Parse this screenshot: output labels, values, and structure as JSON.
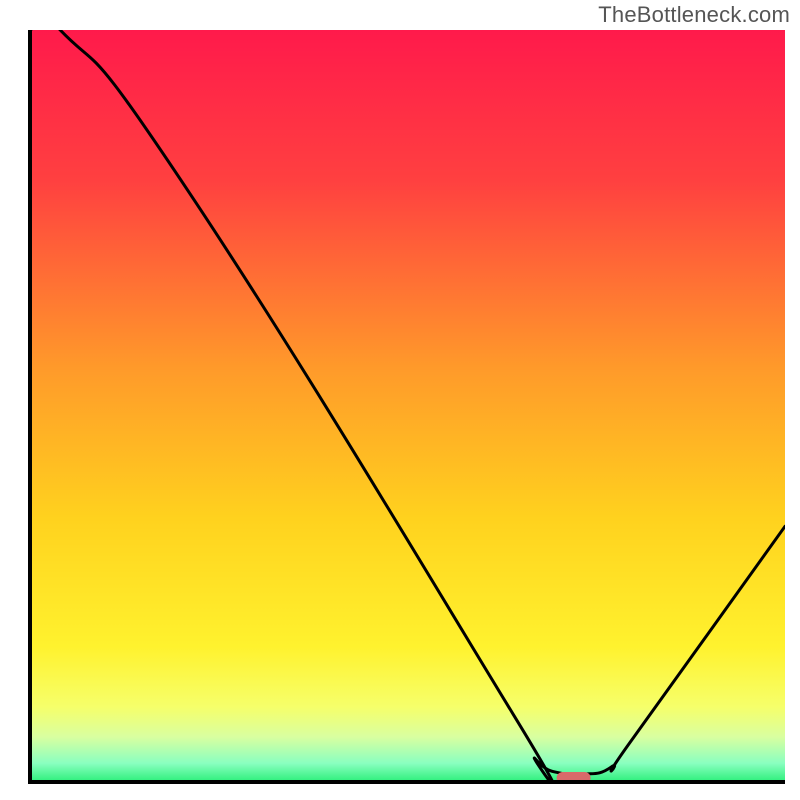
{
  "watermark": "TheBottleneck.com",
  "chart_data": {
    "type": "line",
    "title": "",
    "xlabel": "",
    "ylabel": "",
    "xlim": [
      0,
      100
    ],
    "ylim": [
      0,
      100
    ],
    "x": [
      0,
      4,
      22,
      64,
      67,
      71,
      73,
      77,
      80,
      100
    ],
    "values": [
      100,
      100,
      77,
      9,
      3,
      1,
      1,
      2,
      6,
      34
    ],
    "marker": {
      "x": 72,
      "y": 0
    },
    "gradient_stops": [
      {
        "offset": 0,
        "color": "#ff1a4b"
      },
      {
        "offset": 20,
        "color": "#ff4040"
      },
      {
        "offset": 45,
        "color": "#ff9a2a"
      },
      {
        "offset": 65,
        "color": "#ffd21e"
      },
      {
        "offset": 82,
        "color": "#fff22e"
      },
      {
        "offset": 90,
        "color": "#f6ff6a"
      },
      {
        "offset": 94,
        "color": "#d9ffa0"
      },
      {
        "offset": 97.5,
        "color": "#8affc0"
      },
      {
        "offset": 100,
        "color": "#2bef7a"
      }
    ],
    "axis_color": "#000000",
    "line_color": "#000000",
    "marker_color": "#d86a6a"
  }
}
